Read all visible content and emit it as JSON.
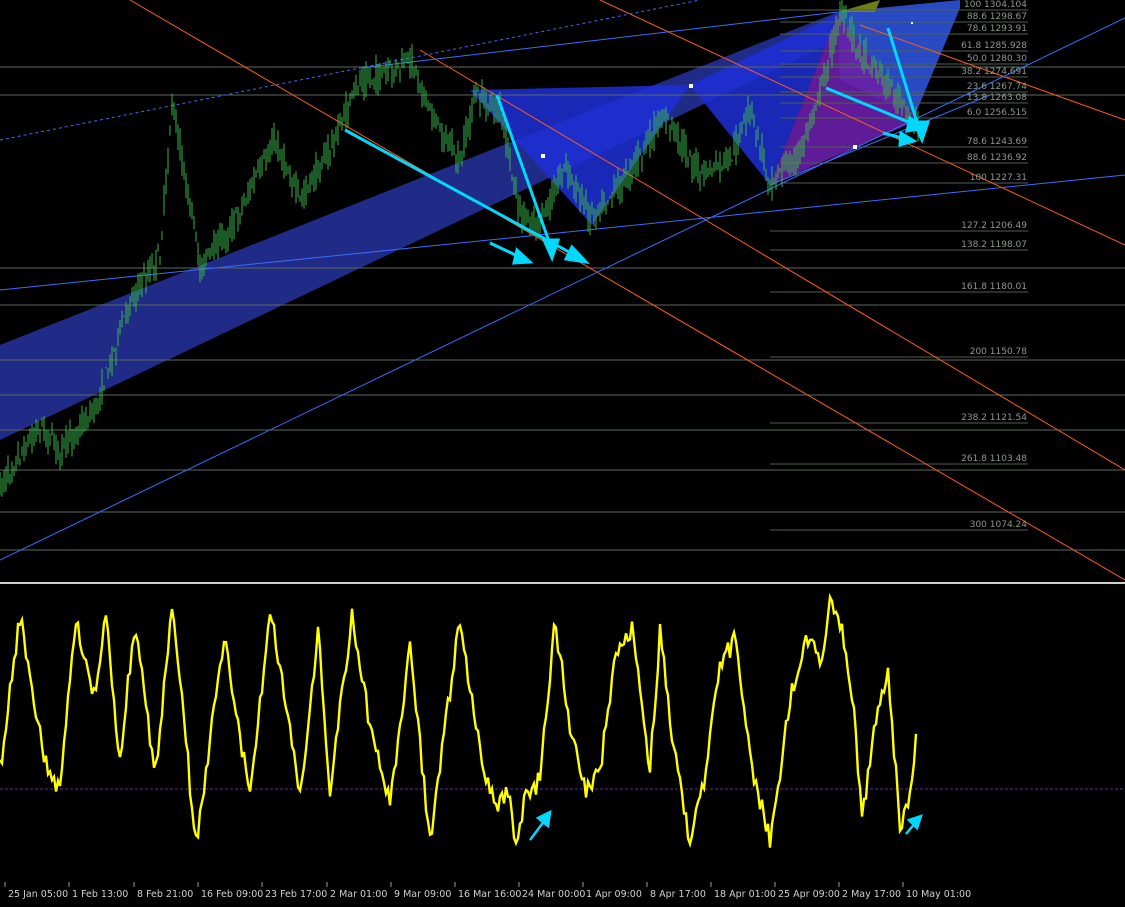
{
  "chart_data": [
    {
      "type": "line",
      "panel": "price",
      "series": [],
      "fibonacci_levels": [
        {
          "ratio": "100",
          "price": "1304.104"
        },
        {
          "ratio": "88.6",
          "price": "1298.67"
        },
        {
          "ratio": "78.6",
          "price": "1293.91"
        },
        {
          "ratio": "61.8",
          "price": "1285.928"
        },
        {
          "ratio": "50.0",
          "price": "1280.30"
        },
        {
          "ratio": "38.2",
          "price": "1274.691"
        },
        {
          "ratio": "23.6",
          "price": "1267.74"
        },
        {
          "ratio": "13.8",
          "price": "1263.08"
        },
        {
          "ratio": "6.0",
          "price": "1256.515"
        },
        {
          "ratio": "78.6",
          "price": "1243.69"
        },
        {
          "ratio": "88.6",
          "price": "1236.92"
        },
        {
          "ratio": "100",
          "price": "1227.31"
        },
        {
          "ratio": "127.2",
          "price": "1206.49"
        },
        {
          "ratio": "138.2",
          "price": "1198.07"
        },
        {
          "ratio": "161.8",
          "price": "1180.01"
        },
        {
          "ratio": "200",
          "price": "1150.78"
        },
        {
          "ratio": "238.2",
          "price": "1121.54"
        },
        {
          "ratio": "261.8",
          "price": "1103.48"
        },
        {
          "ratio": "300",
          "price": "1074.24"
        }
      ],
      "colors": {
        "price_bars": "#39b54a",
        "fib_lines": "#6a7a6a",
        "channel_fill": "#2b35a8",
        "trendline": "#00d8ff",
        "orange_lines": "#ff5a1f",
        "blue_lines": "#3a6cff"
      }
    },
    {
      "type": "line",
      "panel": "oscillator",
      "series": [],
      "colors": {
        "line": "#ffff00",
        "zero_line": "#6a2aa0",
        "arrow": "#00d8ff"
      }
    }
  ],
  "x_axis": {
    "ticks": [
      "25 Jan 05:00",
      "1 Feb 13:00",
      "8 Feb 21:00",
      "16 Feb 09:00",
      "23 Feb 17:00",
      "2 Mar 01:00",
      "9 Mar 09:00",
      "16 Mar 16:00",
      "24 Mar 00:00",
      "1 Apr 09:00",
      "8 Apr 17:00",
      "18 Apr 01:00",
      "25 Apr 09:00",
      "2 May 17:00",
      "10 May 01:00"
    ]
  }
}
